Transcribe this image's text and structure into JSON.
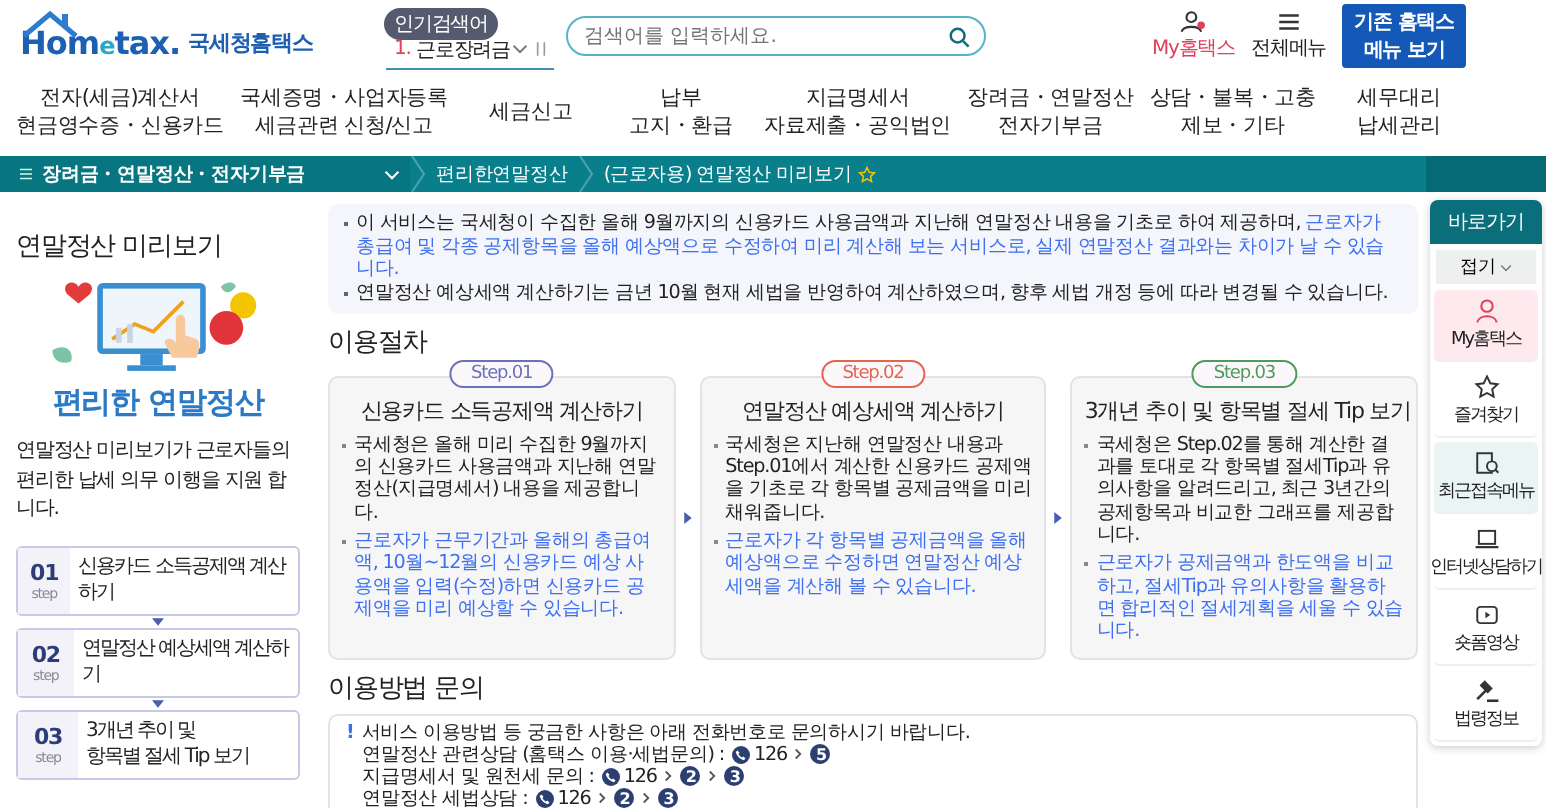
{
  "header": {
    "logo": {
      "brand_main": "Hom",
      "brand_e": "e",
      "brand_tail": "tax.",
      "name": "국세청홈택스"
    },
    "popular": {
      "label": "인기검색어",
      "rank": "1.",
      "term": "근로장려금"
    },
    "search": {
      "placeholder": "검색어를 입력하세요."
    },
    "utilities": [
      {
        "kind": "user",
        "label": "My홈택스"
      },
      {
        "kind": "menu",
        "label": "전체메뉴"
      }
    ],
    "legacy_button": [
      "기존 홈택스",
      "메뉴 보기"
    ]
  },
  "nav": [
    {
      "lines": [
        "전자(세금)계산서",
        "현금영수증・신용카드"
      ]
    },
    {
      "lines": [
        "국세증명・사업자등록",
        "세금관련 신청/신고"
      ]
    },
    {
      "lines": [
        "세금신고"
      ]
    },
    {
      "lines": [
        "납부",
        "고지・환급"
      ]
    },
    {
      "lines": [
        "지급명세서",
        "자료제출・공익법인"
      ]
    },
    {
      "lines": [
        "장려금・연말정산",
        "전자기부금"
      ]
    },
    {
      "lines": [
        "상담・불복・고충",
        "제보・기타"
      ]
    },
    {
      "lines": [
        "세무대리",
        "납세관리"
      ]
    }
  ],
  "breadcrumb": [
    {
      "kind": "menu",
      "label": "장려금・연말정산・전자기부금"
    },
    {
      "kind": "page",
      "label": "편리한연말정산"
    },
    {
      "kind": "current",
      "label": "(근로자용) 연말정산 미리보기",
      "favorite": false
    }
  ],
  "intro": {
    "title": "연말정산 미리보기",
    "banner_caption": "편리한 연말정산",
    "description": "연말정산 미리보기가 근로자들의  편리한 납세 의무 이행을 지원 합니다.",
    "steps": [
      {
        "number": "01",
        "unit": "step",
        "lines": [
          "신용카드 소득공제액 계산하기"
        ]
      },
      {
        "number": "02",
        "unit": "step",
        "lines": [
          "연말정산 예상세액 계산하기"
        ]
      },
      {
        "number": "03",
        "unit": "step",
        "lines": [
          "3개년 추이 및",
          "항목별 절세 Tip 보기"
        ]
      }
    ]
  },
  "notice": [
    {
      "segments": [
        {
          "text": "이 서비스는 국세청이 수집한 올해 9월까지의 신용카드 사용금액과 지난해 연말정산 내용을 기초로 하여 제공하며, ",
          "highlight": false
        },
        {
          "text": "근로자가 총급여 및 각종 공제항목을 올해 예상액으로 수정하여 미리 계산해 보는 서비스로, 실제 연말정산 결과와는 차이가 날 수 있습니다.",
          "highlight": true
        }
      ]
    },
    {
      "segments": [
        {
          "text": "연말정산 예상세액 계산하기는 금년 10월 현재 세법을 반영하여 계산하였으며, 향후 세법 개정 등에 따라 변경될 수 있습니다.",
          "highlight": false
        }
      ]
    }
  ],
  "procedure": {
    "heading": "이용절차",
    "steps": [
      {
        "badge": "Step.01",
        "color": "#6c70b8",
        "title": "신용카드 소득공제액 계산하기",
        "paragraphs": [
          {
            "text": "국세청은 올해 미리 수집한 9월까지의 신용카드 사용금액과 지난해 연말정산(지급명세서) 내용을 제공합니다.",
            "highlight": false
          },
          {
            "text": "근로자가 근무기간과 올해의 총급여액, 10월~12월의 신용카드 예상 사용액을 입력(수정)하면 신용카드 공제액을 미리 예상할 수 있습니다.",
            "highlight": true
          }
        ]
      },
      {
        "badge": "Step.02",
        "color": "#e5644f",
        "title": "연말정산 예상세액 계산하기",
        "paragraphs": [
          {
            "text": "국세청은 지난해 연말정산 내용과 Step.01에서 계산한 신용카드 공제액을 기초로 각 항목별 공제금액을 미리 채워줍니다.",
            "highlight": false
          },
          {
            "text": "근로자가 각 항목별 공제금액을 올해예상액으로 수정하면 연말정산 예상세액을 계산해 볼 수 있습니다.",
            "highlight": true
          }
        ]
      },
      {
        "badge": "Step.03",
        "color": "#4e9b5b",
        "title": "3개년 추이 및 항목별 절세 Tip 보기",
        "paragraphs": [
          {
            "text": "국세청은 Step.02를 통해 계산한 결과를 토대로 각 항목별 절세Tip과 유의사항을 알려드리고, 최근 3년간의 공제항목과 비교한 그래프를 제공합니다.",
            "highlight": false
          },
          {
            "text": "근로자가 공제금액과 한도액을 비교하고, 절세Tip과 유의사항을 활용하면 합리적인 절세계획을 세울 수 있습니다.",
            "highlight": true
          }
        ]
      }
    ]
  },
  "inquiry": {
    "heading": "이용방법 문의",
    "mark": "!",
    "intro": "서비스 이용방법 등 궁금한 사항은 아래 전화번호로 문의하시기 바랍니다.",
    "contacts": [
      {
        "label": "연말정산 관련상담 (홈택스 이용·세법문의) :",
        "number": "126",
        "options": [
          "5"
        ]
      },
      {
        "label": "지급명세서 및 원천세 문의 :",
        "number": "126",
        "options": [
          "2",
          "3"
        ]
      },
      {
        "label": "연말정산 세법상담 :",
        "number": "126",
        "options": [
          "2",
          "3"
        ]
      }
    ]
  },
  "quick": {
    "title": "바로가기",
    "collapse": "접기",
    "items": [
      {
        "kind": "user",
        "label": "My홈택스",
        "color": "#fde9ee"
      },
      {
        "kind": "star",
        "label": "즐겨찾기",
        "color": "#ffffff"
      },
      {
        "kind": "recent",
        "label": "최근접속메뉴",
        "color": "#e8f5f4"
      },
      {
        "kind": "laptop",
        "label": "인터넷상담하기",
        "color": "#ffffff"
      },
      {
        "kind": "video",
        "label": "숏폼영상",
        "color": "#ffffff"
      },
      {
        "kind": "gavel",
        "label": "법령정보",
        "color": "#ffffff"
      }
    ]
  }
}
